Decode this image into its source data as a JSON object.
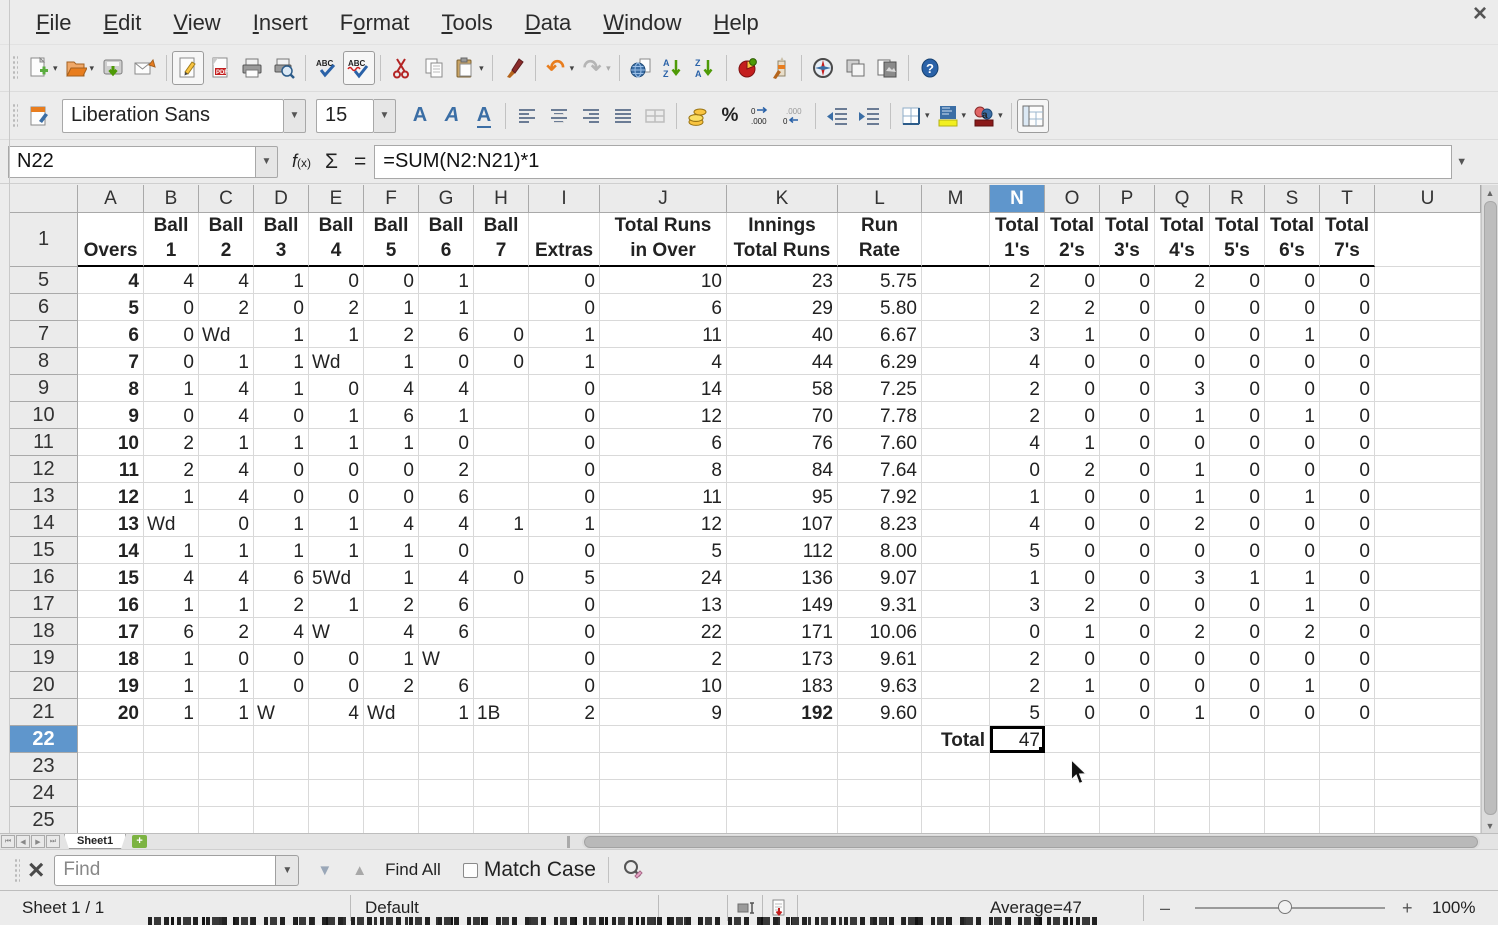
{
  "menu_bar": {
    "items": [
      {
        "label": "File",
        "accel_index": 0
      },
      {
        "label": "Edit",
        "accel_index": 0
      },
      {
        "label": "View",
        "accel_index": 0
      },
      {
        "label": "Insert",
        "accel_index": 0
      },
      {
        "label": "Format",
        "accel_index": 1
      },
      {
        "label": "Tools",
        "accel_index": 0
      },
      {
        "label": "Data",
        "accel_index": 0
      },
      {
        "label": "Window",
        "accel_index": 0
      },
      {
        "label": "Help",
        "accel_index": 0
      }
    ],
    "close_glyph": "×"
  },
  "standard_toolbar": {
    "buttons": [
      "new-document",
      "open",
      "save",
      "email-document",
      "edit-mode",
      "export-pdf",
      "print",
      "print-preview",
      "spelling",
      "auto-spellcheck",
      "cut",
      "copy",
      "paste",
      "clone-formatting",
      "undo",
      "redo",
      "hyperlink",
      "sort-ascending",
      "sort-descending",
      "insert-chart",
      "draw-functions",
      "navigator",
      "styles",
      "gallery",
      "help"
    ]
  },
  "formatting_toolbar": {
    "font_name": "Liberation Sans",
    "font_size": "15",
    "buttons": [
      "styles-panel",
      "bold",
      "italic",
      "underline",
      "align-left",
      "align-center",
      "align-right",
      "align-justify",
      "merge-cells",
      "currency",
      "percent",
      "add-decimal",
      "delete-decimal",
      "decrease-indent",
      "increase-indent",
      "borders",
      "background-color",
      "font-color",
      "sidebar"
    ]
  },
  "formula_bar": {
    "cell_reference": "N22",
    "formula": "=SUM(N2:N21)*1",
    "sum_glyph": "Σ",
    "equals_glyph": "="
  },
  "grid": {
    "column_letters": [
      "A",
      "B",
      "C",
      "D",
      "E",
      "F",
      "G",
      "H",
      "I",
      "J",
      "K",
      "L",
      "M",
      "N",
      "O",
      "P",
      "Q",
      "R",
      "S",
      "T",
      "U"
    ],
    "selection": {
      "column": "N",
      "row": "22",
      "cell_reference": "N22"
    },
    "rows": [
      {
        "r": "1",
        "cells": {
          "A": "Overs",
          "B": "Ball\n1",
          "C": "Ball\n2",
          "D": "Ball\n3",
          "E": "Ball\n4",
          "F": "Ball\n5",
          "G": "Ball\n6",
          "H": "Ball\n7",
          "I": "Extras",
          "J": "Total Runs\nin Over",
          "K": "Innings\nTotal Runs",
          "L": "Run\nRate",
          "N": "Total\n1's",
          "O": "Total\n2's",
          "P": "Total\n3's",
          "Q": "Total\n4's",
          "R": "Total\n5's",
          "S": "Total\n6's",
          "T": "Total\n7's"
        }
      },
      {
        "r": "5",
        "cells": {
          "A": "4",
          "B": "4",
          "C": "4",
          "D": "1",
          "E": "0",
          "F": "0",
          "G": "1",
          "I": "0",
          "J": "10",
          "K": "23",
          "L": "5.75",
          "N": "2",
          "O": "0",
          "P": "0",
          "Q": "2",
          "R": "0",
          "S": "0",
          "T": "0"
        }
      },
      {
        "r": "6",
        "cells": {
          "A": "5",
          "B": "0",
          "C": "2",
          "D": "0",
          "E": "2",
          "F": "1",
          "G": "1",
          "I": "0",
          "J": "6",
          "K": "29",
          "L": "5.80",
          "N": "2",
          "O": "2",
          "P": "0",
          "Q": "0",
          "R": "0",
          "S": "0",
          "T": "0"
        }
      },
      {
        "r": "7",
        "cells": {
          "A": "6",
          "B": "0",
          "C": "Wd",
          "D": "1",
          "E": "1",
          "F": "2",
          "G": "6",
          "H": "0",
          "I": "1",
          "J": "11",
          "K": "40",
          "L": "6.67",
          "N": "3",
          "O": "1",
          "P": "0",
          "Q": "0",
          "R": "0",
          "S": "1",
          "T": "0"
        }
      },
      {
        "r": "8",
        "cells": {
          "A": "7",
          "B": "0",
          "C": "1",
          "D": "1",
          "E": "Wd",
          "F": "1",
          "G": "0",
          "H": "0",
          "I": "1",
          "J": "4",
          "K": "44",
          "L": "6.29",
          "N": "4",
          "O": "0",
          "P": "0",
          "Q": "0",
          "R": "0",
          "S": "0",
          "T": "0"
        }
      },
      {
        "r": "9",
        "cells": {
          "A": "8",
          "B": "1",
          "C": "4",
          "D": "1",
          "E": "0",
          "F": "4",
          "G": "4",
          "I": "0",
          "J": "14",
          "K": "58",
          "L": "7.25",
          "N": "2",
          "O": "0",
          "P": "0",
          "Q": "3",
          "R": "0",
          "S": "0",
          "T": "0"
        }
      },
      {
        "r": "10",
        "cells": {
          "A": "9",
          "B": "0",
          "C": "4",
          "D": "0",
          "E": "1",
          "F": "6",
          "G": "1",
          "I": "0",
          "J": "12",
          "K": "70",
          "L": "7.78",
          "N": "2",
          "O": "0",
          "P": "0",
          "Q": "1",
          "R": "0",
          "S": "1",
          "T": "0"
        }
      },
      {
        "r": "11",
        "cells": {
          "A": "10",
          "B": "2",
          "C": "1",
          "D": "1",
          "E": "1",
          "F": "1",
          "G": "0",
          "I": "0",
          "J": "6",
          "K": "76",
          "L": "7.60",
          "N": "4",
          "O": "1",
          "P": "0",
          "Q": "0",
          "R": "0",
          "S": "0",
          "T": "0"
        }
      },
      {
        "r": "12",
        "cells": {
          "A": "11",
          "B": "2",
          "C": "4",
          "D": "0",
          "E": "0",
          "F": "0",
          "G": "2",
          "I": "0",
          "J": "8",
          "K": "84",
          "L": "7.64",
          "N": "0",
          "O": "2",
          "P": "0",
          "Q": "1",
          "R": "0",
          "S": "0",
          "T": "0"
        }
      },
      {
        "r": "13",
        "cells": {
          "A": "12",
          "B": "1",
          "C": "4",
          "D": "0",
          "E": "0",
          "F": "0",
          "G": "6",
          "I": "0",
          "J": "11",
          "K": "95",
          "L": "7.92",
          "N": "1",
          "O": "0",
          "P": "0",
          "Q": "1",
          "R": "0",
          "S": "1",
          "T": "0"
        }
      },
      {
        "r": "14",
        "cells": {
          "A": "13",
          "B": "Wd",
          "C": "0",
          "D": "1",
          "E": "1",
          "F": "4",
          "G": "4",
          "H": "1",
          "I": "1",
          "J": "12",
          "K": "107",
          "L": "8.23",
          "N": "4",
          "O": "0",
          "P": "0",
          "Q": "2",
          "R": "0",
          "S": "0",
          "T": "0"
        }
      },
      {
        "r": "15",
        "cells": {
          "A": "14",
          "B": "1",
          "C": "1",
          "D": "1",
          "E": "1",
          "F": "1",
          "G": "0",
          "I": "0",
          "J": "5",
          "K": "112",
          "L": "8.00",
          "N": "5",
          "O": "0",
          "P": "0",
          "Q": "0",
          "R": "0",
          "S": "0",
          "T": "0"
        }
      },
      {
        "r": "16",
        "cells": {
          "A": "15",
          "B": "4",
          "C": "4",
          "D": "6",
          "E": "5Wd",
          "F": "1",
          "G": "4",
          "H": "0",
          "I": "5",
          "J": "24",
          "K": "136",
          "L": "9.07",
          "N": "1",
          "O": "0",
          "P": "0",
          "Q": "3",
          "R": "1",
          "S": "1",
          "T": "0"
        }
      },
      {
        "r": "17",
        "cells": {
          "A": "16",
          "B": "1",
          "C": "1",
          "D": "2",
          "E": "1",
          "F": "2",
          "G": "6",
          "I": "0",
          "J": "13",
          "K": "149",
          "L": "9.31",
          "N": "3",
          "O": "2",
          "P": "0",
          "Q": "0",
          "R": "0",
          "S": "1",
          "T": "0"
        }
      },
      {
        "r": "18",
        "cells": {
          "A": "17",
          "B": "6",
          "C": "2",
          "D": "4",
          "E": "W",
          "F": "4",
          "G": "6",
          "I": "0",
          "J": "22",
          "K": "171",
          "L": "10.06",
          "N": "0",
          "O": "1",
          "P": "0",
          "Q": "2",
          "R": "0",
          "S": "2",
          "T": "0"
        }
      },
      {
        "r": "19",
        "cells": {
          "A": "18",
          "B": "1",
          "C": "0",
          "D": "0",
          "E": "0",
          "F": "1",
          "G": "W",
          "I": "0",
          "J": "2",
          "K": "173",
          "L": "9.61",
          "N": "2",
          "O": "0",
          "P": "0",
          "Q": "0",
          "R": "0",
          "S": "0",
          "T": "0"
        }
      },
      {
        "r": "20",
        "cells": {
          "A": "19",
          "B": "1",
          "C": "1",
          "D": "0",
          "E": "0",
          "F": "2",
          "G": "6",
          "I": "0",
          "J": "10",
          "K": "183",
          "L": "9.63",
          "N": "2",
          "O": "1",
          "P": "0",
          "Q": "0",
          "R": "0",
          "S": "1",
          "T": "0"
        }
      },
      {
        "r": "21",
        "cells": {
          "A": "20",
          "B": "1",
          "C": "1",
          "D": "W",
          "E": "4",
          "F": "Wd",
          "G": "1",
          "H": "1B",
          "I": "2",
          "J": "9",
          "K": "192",
          "L": "9.60",
          "N": "5",
          "O": "0",
          "P": "0",
          "Q": "1",
          "R": "0",
          "S": "0",
          "T": "0"
        },
        "bold": [
          "K"
        ]
      },
      {
        "r": "22",
        "cells": {
          "M": "Total",
          "N": "47"
        },
        "bold": [
          "M"
        ],
        "right": [
          "M"
        ]
      },
      {
        "r": "23",
        "cells": {}
      },
      {
        "r": "24",
        "cells": {}
      },
      {
        "r": "25",
        "cells": {}
      }
    ]
  },
  "sheet_tabs": {
    "active_tab": "Sheet1",
    "nav_icons": [
      "first-sheet",
      "previous-sheet",
      "next-sheet",
      "last-sheet"
    ],
    "add_sheet_glyph": "+"
  },
  "find_bar": {
    "placeholder": "Find",
    "find_all_label": "Find All",
    "match_case_label": "Match Case",
    "close_glyph": "×"
  },
  "status_bar": {
    "sheet_label": "Sheet 1 / 1",
    "style_name": "Default",
    "average_label": "Average=47",
    "zoom_percent": "100%",
    "zoom_minus": "–",
    "zoom_plus": "+"
  }
}
